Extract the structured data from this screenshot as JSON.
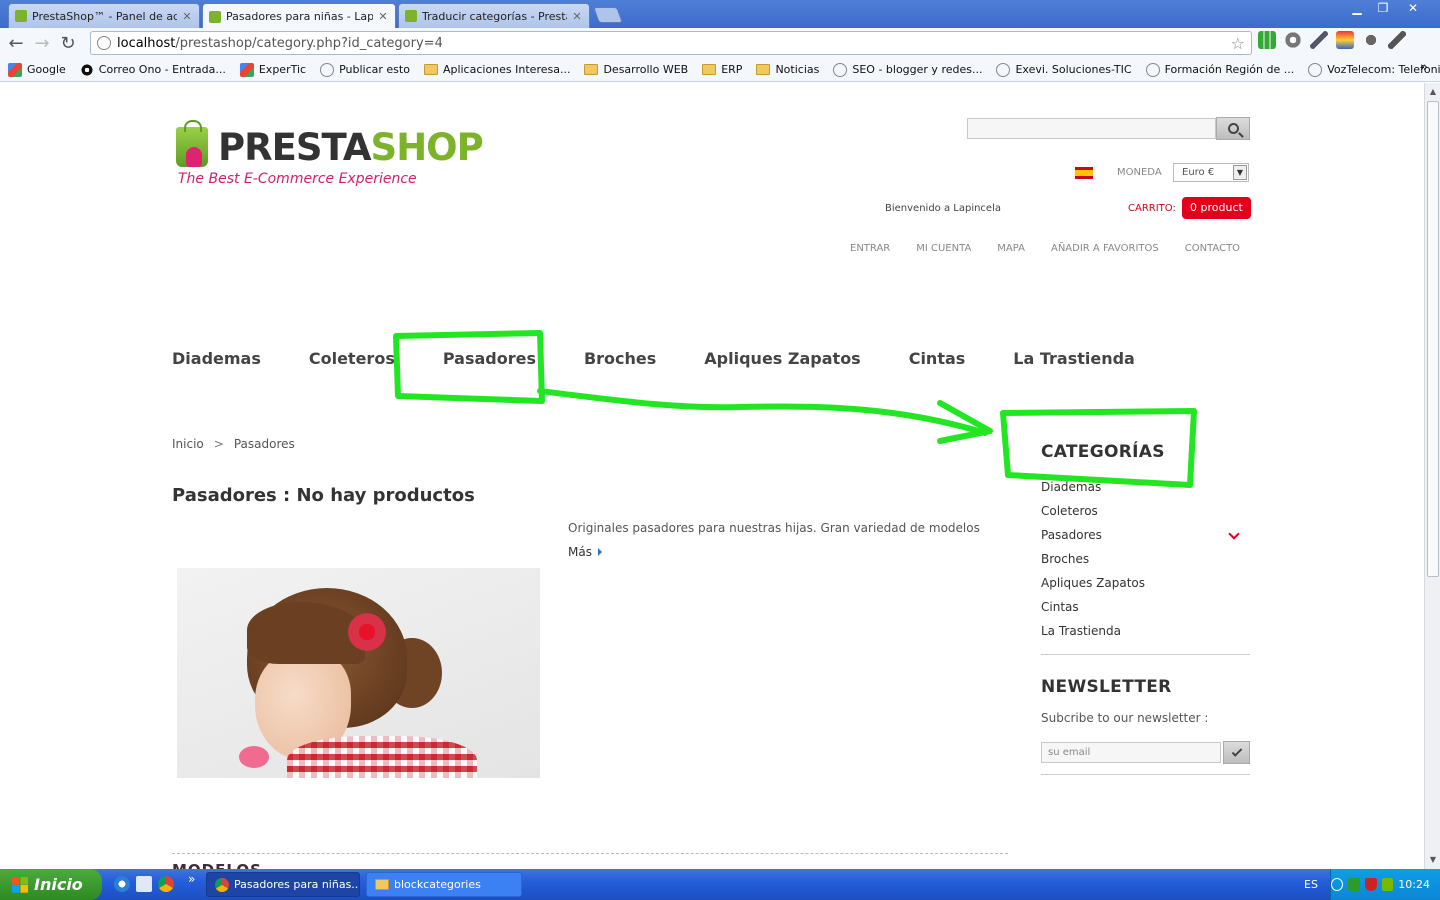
{
  "browser": {
    "tabs": [
      {
        "title": "PrestaShop™ - Panel de admin",
        "active": false
      },
      {
        "title": "Pasadores para niñas - Lapinc",
        "active": true
      },
      {
        "title": "Traducir categorías - PrestaSh",
        "active": false
      }
    ],
    "url_host": "localhost",
    "url_path": "/prestashop/category.php?id_category=4",
    "bookmarks": [
      {
        "label": "Google",
        "icon": "google-icon"
      },
      {
        "label": "Correo Ono - Entrada...",
        "icon": "eye-icon"
      },
      {
        "label": "ExperTic",
        "icon": "google-icon"
      },
      {
        "label": "Publicar esto",
        "icon": "globe-icon"
      },
      {
        "label": "Aplicaciones Interesa...",
        "icon": "folder-icon"
      },
      {
        "label": "Desarrollo WEB",
        "icon": "folder-icon"
      },
      {
        "label": "ERP",
        "icon": "folder-icon"
      },
      {
        "label": "Noticias",
        "icon": "folder-icon"
      },
      {
        "label": "SEO - blogger y redes...",
        "icon": "globe-icon"
      },
      {
        "label": "Exevi. Soluciones-TIC",
        "icon": "globe-icon"
      },
      {
        "label": "Formación Región de ...",
        "icon": "globe-icon"
      },
      {
        "label": "VozTelecom: Telefoni...",
        "icon": "globe-icon"
      }
    ],
    "bookmarks_more": "»"
  },
  "shop": {
    "logo_brand_a": "PRESTA",
    "logo_brand_b": "SHOP",
    "logo_tagline": "The Best E-Commerce Experience",
    "currency_label": "MONEDA",
    "currency_value": "Euro €",
    "welcome": "Bienvenido a Lapincela",
    "cart_label": "CARRITO:",
    "cart_count": "0 product",
    "user_links": [
      "ENTRAR",
      "MI CUENTA",
      "MAPA",
      "AÑADIR A FAVORITOS",
      "CONTACTO"
    ],
    "menu": [
      "Diademas",
      "Coleteros",
      "Pasadores",
      "Broches",
      "Apliques Zapatos",
      "Cintas",
      "La Trastienda"
    ],
    "breadcrumb": {
      "home": "Inicio",
      "sep": ">",
      "current": "Pasadores"
    },
    "page_title": "Pasadores : No hay productos",
    "description": "Originales pasadores para nuestras hijas. Gran variedad de modelos",
    "more": "Más",
    "section_truncated": "MODELOS",
    "categories_title": "CATEGORÍAS",
    "categories": [
      "Diademas",
      "Coleteros",
      "Pasadores",
      "Broches",
      "Apliques Zapatos",
      "Cintas",
      "La Trastienda"
    ],
    "newsletter_title": "NEWSLETTER",
    "newsletter_text": "Subcribe to our newsletter :",
    "newsletter_placeholder": "su email"
  },
  "taskbar": {
    "start": "Inicio",
    "items": [
      {
        "label": "Pasadores para niñas...",
        "active": true
      },
      {
        "label": "blockcategories",
        "active": false
      }
    ],
    "lang": "ES",
    "clock": "10:24"
  },
  "colors": {
    "annotation": "#22e622",
    "cart_red": "#e2001a",
    "brand_green": "#7cb32b",
    "brand_pink": "#d1206f"
  }
}
